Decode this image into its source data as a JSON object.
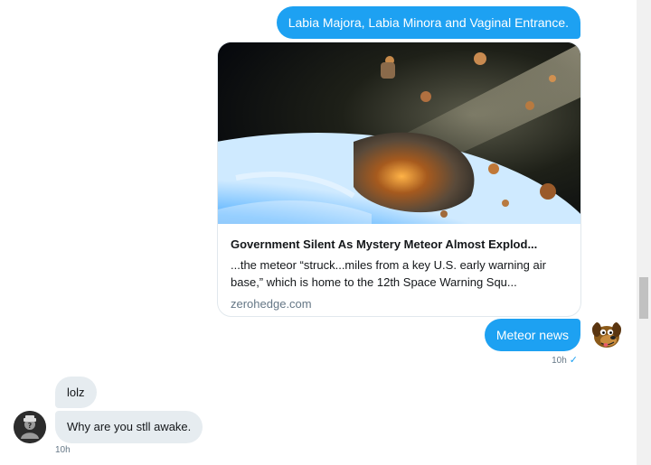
{
  "conversation": {
    "messages": [
      {
        "direction": "outgoing",
        "text": "Labia Majora, Labia Minora and Vaginal Entrance."
      },
      {
        "direction": "outgoing",
        "type": "link-card",
        "card": {
          "title": "Government Silent As Mystery Meteor Almost Explod...",
          "description": "...the meteor “struck...miles from a key U.S. early warning air base,” which is home to the 12th Space Warning Squ...",
          "domain": "zerohedge.com"
        }
      },
      {
        "direction": "outgoing",
        "text": "Meteor news",
        "time": "10h",
        "status": "✓"
      },
      {
        "direction": "incoming",
        "text": "lolz"
      },
      {
        "direction": "incoming",
        "text": "Why are you stll awake.",
        "time": "10h"
      }
    ]
  },
  "colors": {
    "outgoing_bubble": "#1da1f2",
    "incoming_bubble": "#e6ecf0",
    "meta_text": "#657786"
  },
  "icons": {
    "self_avatar": "cartoon-dog-avatar",
    "other_avatar": "incognito-avatar",
    "read_receipt": "checkmark-icon"
  }
}
